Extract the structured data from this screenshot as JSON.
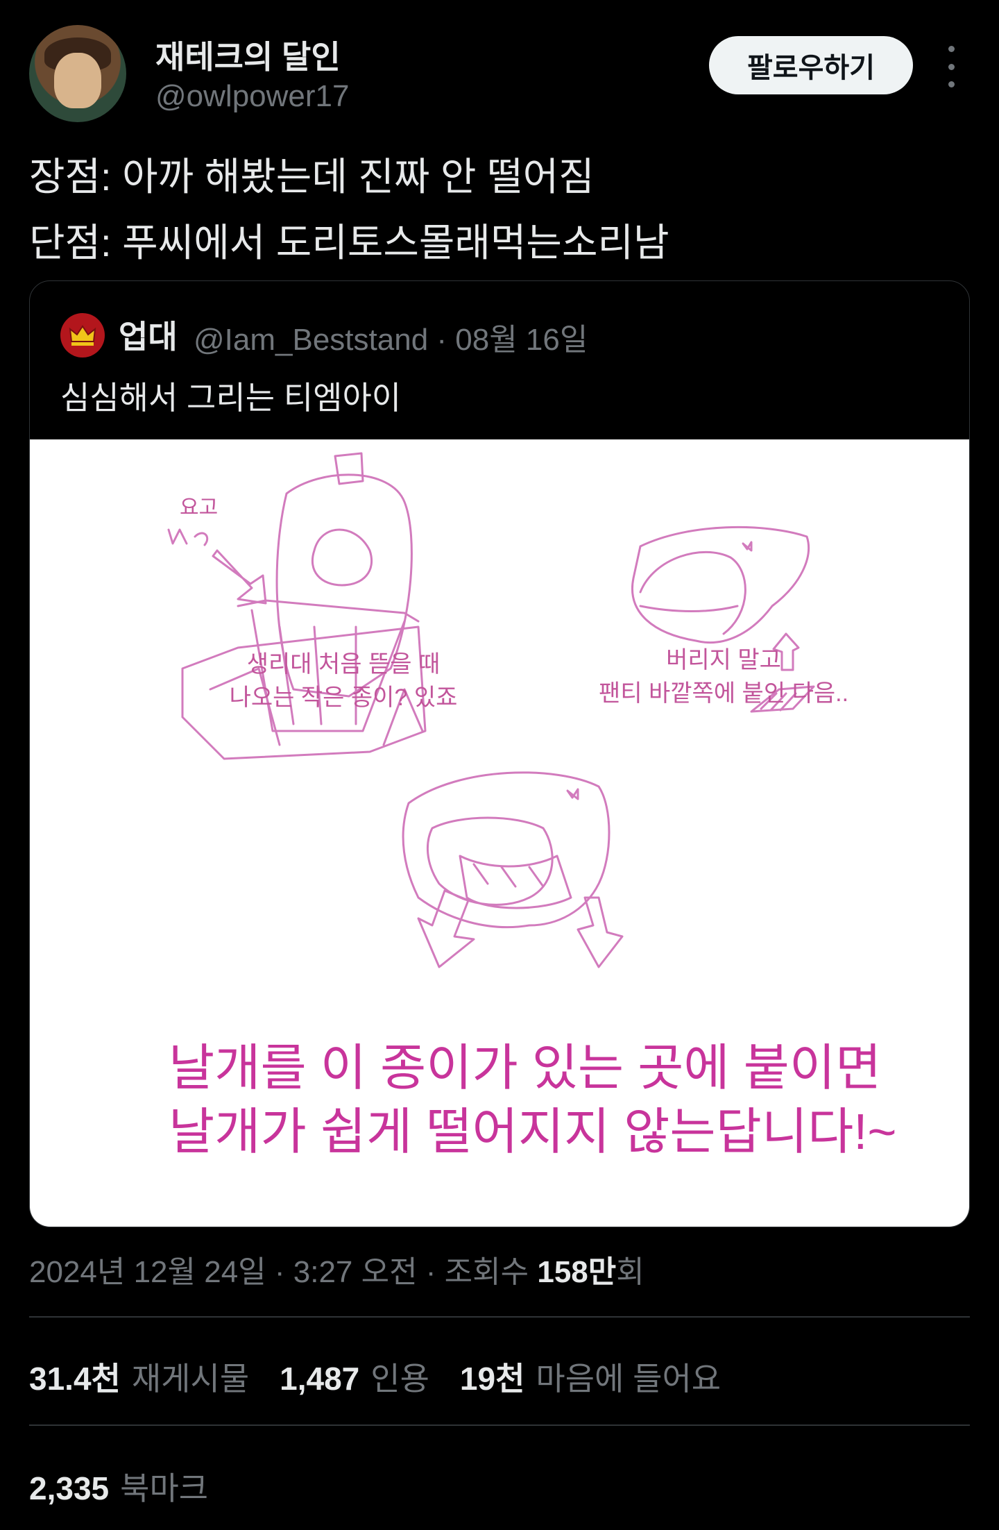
{
  "author": {
    "display_name": "재테크의 달인",
    "handle": "@owlpower17",
    "follow_label": "팔로우하기"
  },
  "tweet": {
    "lines": [
      "장점: 아까 해봤는데 진짜 안 떨어짐",
      "단점: 푸씨에서 도리토스몰래먹는소리남"
    ]
  },
  "quote": {
    "author_name": "업대",
    "author_handle": "@Iam_Beststand · 08월 16일",
    "text": "심심해서 그리는 티엠아이",
    "image": {
      "label_top_left": "요고",
      "caption_left": [
        "생리대 처음 뜯을 때",
        "나오는 작은 종이? 있죠"
      ],
      "caption_right": [
        "버리지 말고",
        "팬티 바깥쪽에 붙인 다음.."
      ],
      "caption_bottom": [
        "날개를 이 종이가 있는 곳에 붙이면",
        "날개가 쉽게 떨어지지 않는답니다!~"
      ]
    }
  },
  "meta": {
    "date_time": "2024년 12월 24일 · 3:27 오전 · 조회수 ",
    "views": "158만",
    "views_suffix": "회"
  },
  "stats": {
    "reposts_value": "31.4천",
    "reposts_label": "재게시물",
    "quotes_value": "1,487",
    "quotes_label": "인용",
    "likes_value": "19천",
    "likes_label": "마음에 들어요",
    "bookmarks_value": "2,335",
    "bookmarks_label": "북마크"
  },
  "colors": {
    "background": "#000000",
    "text": "#e7e9ea",
    "muted": "#71767b",
    "drawing": "#c2559b"
  }
}
